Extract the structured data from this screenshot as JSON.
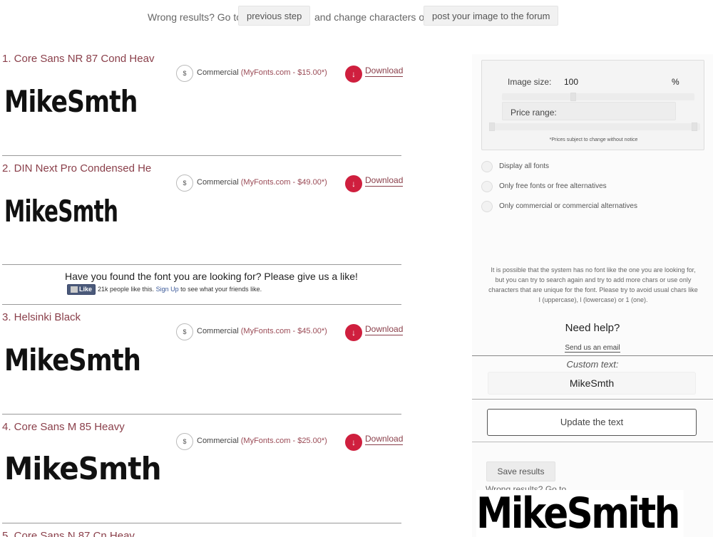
{
  "top_bar": {
    "prefix": "Wrong results? Go to",
    "previous_step": "previous step",
    "middle": "and change characters or",
    "post_forum": "post your image to the forum"
  },
  "results": [
    {
      "title": "1. Core Sans NR 87 Cond Heav",
      "license": "Commercial",
      "source": "(MyFonts.com - $15.00*)",
      "download": "Download",
      "sample": "MikeSmth",
      "dollar": "$",
      "arrow": "↓"
    },
    {
      "title": "2. DIN Next Pro Condensed He",
      "license": "Commercial",
      "source": "(MyFonts.com - $49.00*)",
      "download": "Download",
      "sample": "MikeSmth",
      "dollar": "$",
      "arrow": "↓"
    },
    {
      "title": "3. Helsinki Black",
      "license": "Commercial",
      "source": "(MyFonts.com - $45.00*)",
      "download": "Download",
      "sample": "MikeSmth",
      "dollar": "$",
      "arrow": "↓"
    },
    {
      "title": "4. Core Sans M 85 Heavy",
      "license": "Commercial",
      "source": "(MyFonts.com - $25.00*)",
      "download": "Download",
      "sample": "MikeSmth",
      "dollar": "$",
      "arrow": "↓"
    },
    {
      "title": "5. Core Sans N 87 Cn Heav"
    }
  ],
  "like_box": {
    "question": "Have you found the font you are looking for? Please give us a like!",
    "like_button": "Like",
    "count_text": "21k people like this.",
    "signup": "Sign Up",
    "signup_suffix": "to see what your friends like."
  },
  "sidebar": {
    "image_size_label": "Image size:",
    "image_size_value": "100",
    "image_size_unit": "%",
    "price_range_label": "Price range:",
    "price_note": "*Prices subject to change without notice",
    "radio_options": [
      "Display all fonts",
      "Only free fonts or free alternatives",
      "Only commercial or commercial alternatives"
    ],
    "info": "It is possible that the system has no font like the one you are looking for, but you can try to search again and try to add more chars or use only characters that are unique for the font. Please try to avoid usual chars like I (uppercase), l (lowercase) or 1 (one).",
    "help_title": "Need help?",
    "email_link": "Send us an email",
    "custom_text_label": "Custom text:",
    "custom_text_value": "MikeSmth",
    "update_button": "Update the text",
    "save_button": "Save results",
    "wrong_results_cut": "Wrong results? Go to"
  },
  "overlay_text": "MikeSmith"
}
